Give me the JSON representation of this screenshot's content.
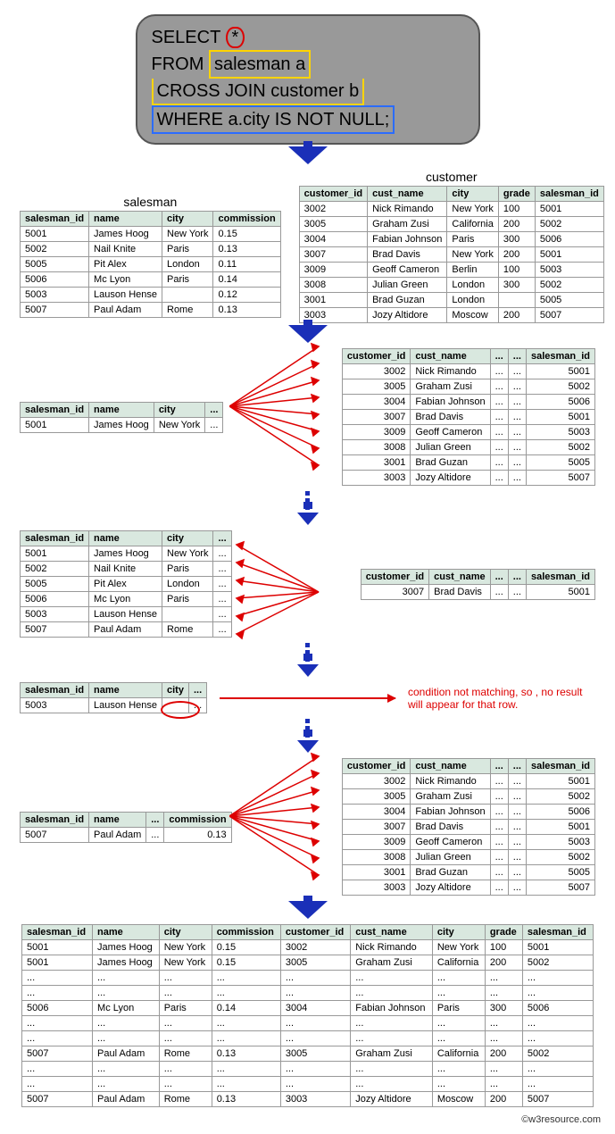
{
  "sql": {
    "line1a": "SELECT",
    "star": "*",
    "line2a": "FROM",
    "line2b": "salesman a",
    "line3": "CROSS JOIN customer b",
    "line4": "WHERE a.city IS NOT NULL;"
  },
  "titles": {
    "salesman": "salesman",
    "customer": "customer"
  },
  "salesman": {
    "headers": [
      "salesman_id",
      "name",
      "city",
      "commission"
    ],
    "rows": [
      [
        "5001",
        "James Hoog",
        "New York",
        "0.15"
      ],
      [
        "5002",
        "Nail Knite",
        "Paris",
        "0.13"
      ],
      [
        "5005",
        "Pit Alex",
        "London",
        "0.11"
      ],
      [
        "5006",
        "Mc Lyon",
        "Paris",
        "0.14"
      ],
      [
        "5003",
        "Lauson Hense",
        "",
        "0.12"
      ],
      [
        "5007",
        "Paul Adam",
        "Rome",
        "0.13"
      ]
    ]
  },
  "customer": {
    "headers": [
      "customer_id",
      "cust_name",
      "city",
      "grade",
      "salesman_id"
    ],
    "rows": [
      [
        "3002",
        "Nick Rimando",
        "New York",
        "100",
        "5001"
      ],
      [
        "3005",
        "Graham Zusi",
        "California",
        "200",
        "5002"
      ],
      [
        "3004",
        "Fabian Johnson",
        "Paris",
        "300",
        "5006"
      ],
      [
        "3007",
        "Brad Davis",
        "New York",
        "200",
        "5001"
      ],
      [
        "3009",
        "Geoff Cameron",
        "Berlin",
        "100",
        "5003"
      ],
      [
        "3008",
        "Julian Green",
        "London",
        "300",
        "5002"
      ],
      [
        "3001",
        "Brad Guzan",
        "London",
        "",
        "5005"
      ],
      [
        "3003",
        "Jozy Altidore",
        "Moscow",
        "200",
        "5007"
      ]
    ]
  },
  "step1": {
    "left": {
      "headers": [
        "salesman_id",
        "name",
        "city",
        "..."
      ],
      "row": [
        "5001",
        "James Hoog",
        "New York",
        "..."
      ]
    },
    "right": {
      "headers": [
        "customer_id",
        "cust_name",
        "...",
        "...",
        "salesman_id"
      ],
      "rows": [
        [
          "3002",
          "Nick Rimando",
          "...",
          "...",
          "5001"
        ],
        [
          "3005",
          "Graham Zusi",
          "...",
          "...",
          "5002"
        ],
        [
          "3004",
          "Fabian Johnson",
          "...",
          "...",
          "5006"
        ],
        [
          "3007",
          "Brad Davis",
          "...",
          "...",
          "5001"
        ],
        [
          "3009",
          "Geoff Cameron",
          "...",
          "...",
          "5003"
        ],
        [
          "3008",
          "Julian Green",
          "...",
          "...",
          "5002"
        ],
        [
          "3001",
          "Brad Guzan",
          "...",
          "...",
          "5005"
        ],
        [
          "3003",
          "Jozy Altidore",
          "...",
          "...",
          "5007"
        ]
      ]
    }
  },
  "step2": {
    "left": {
      "headers": [
        "salesman_id",
        "name",
        "city",
        "..."
      ],
      "rows": [
        [
          "5001",
          "James Hoog",
          "New York",
          "..."
        ],
        [
          "5002",
          "Nail Knite",
          "Paris",
          "..."
        ],
        [
          "5005",
          "Pit Alex",
          "London",
          "..."
        ],
        [
          "5006",
          "Mc Lyon",
          "Paris",
          "..."
        ],
        [
          "5003",
          "Lauson Hense",
          "",
          "..."
        ],
        [
          "5007",
          "Paul Adam",
          "Rome",
          "..."
        ]
      ]
    },
    "right": {
      "headers": [
        "customer_id",
        "cust_name",
        "...",
        "...",
        "salesman_id"
      ],
      "row": [
        "3007",
        "Brad Davis",
        "...",
        "...",
        "5001"
      ]
    }
  },
  "step3": {
    "left": {
      "headers": [
        "salesman_id",
        "name",
        "city",
        "..."
      ],
      "row": [
        "5003",
        "Lauson Hense",
        "",
        "..."
      ]
    },
    "note": "condition not matching, so , no result will appear for that row."
  },
  "step4": {
    "left": {
      "headers": [
        "salesman_id",
        "name",
        "...",
        "commission"
      ],
      "row": [
        "5007",
        "Paul Adam",
        "...",
        "0.13"
      ]
    },
    "right": {
      "headers": [
        "customer_id",
        "cust_name",
        "...",
        "...",
        "salesman_id"
      ],
      "rows": [
        [
          "3002",
          "Nick Rimando",
          "...",
          "...",
          "5001"
        ],
        [
          "3005",
          "Graham Zusi",
          "...",
          "...",
          "5002"
        ],
        [
          "3004",
          "Fabian Johnson",
          "...",
          "...",
          "5006"
        ],
        [
          "3007",
          "Brad Davis",
          "...",
          "...",
          "5001"
        ],
        [
          "3009",
          "Geoff Cameron",
          "...",
          "...",
          "5003"
        ],
        [
          "3008",
          "Julian Green",
          "...",
          "...",
          "5002"
        ],
        [
          "3001",
          "Brad Guzan",
          "...",
          "...",
          "5005"
        ],
        [
          "3003",
          "Jozy Altidore",
          "...",
          "...",
          "5007"
        ]
      ]
    }
  },
  "result": {
    "headers": [
      "salesman_id",
      "name",
      "city",
      "commission",
      "customer_id",
      "cust_name",
      "city",
      "grade",
      "salesman_id"
    ],
    "rows": [
      [
        "5001",
        "James Hoog",
        "New York",
        "0.15",
        "3002",
        "Nick Rimando",
        "New York",
        "100",
        "5001"
      ],
      [
        "5001",
        "James Hoog",
        "New York",
        "0.15",
        "3005",
        "Graham Zusi",
        "California",
        "200",
        "5002"
      ],
      [
        "...",
        "...",
        "...",
        "...",
        "...",
        "...",
        "...",
        "...",
        "..."
      ],
      [
        "...",
        "...",
        "...",
        "...",
        "...",
        "...",
        "...",
        "...",
        "..."
      ],
      [
        "5006",
        "Mc Lyon",
        "Paris",
        "0.14",
        "3004",
        "Fabian Johnson",
        "Paris",
        "300",
        "5006"
      ],
      [
        "...",
        "...",
        "...",
        "...",
        "...",
        "...",
        "...",
        "...",
        "..."
      ],
      [
        "...",
        "...",
        "...",
        "...",
        "...",
        "...",
        "...",
        "...",
        "..."
      ],
      [
        "5007",
        "Paul Adam",
        "Rome",
        "0.13",
        "3005",
        "Graham Zusi",
        "California",
        "200",
        "5002"
      ],
      [
        "...",
        "...",
        "...",
        "...",
        "...",
        "...",
        "...",
        "...",
        "..."
      ],
      [
        "...",
        "...",
        "...",
        "...",
        "...",
        "...",
        "...",
        "...",
        "..."
      ],
      [
        "5007",
        "Paul Adam",
        "Rome",
        "0.13",
        "3003",
        "Jozy Altidore",
        "Moscow",
        "200",
        "5007"
      ]
    ]
  },
  "footer": "©w3resource.com"
}
